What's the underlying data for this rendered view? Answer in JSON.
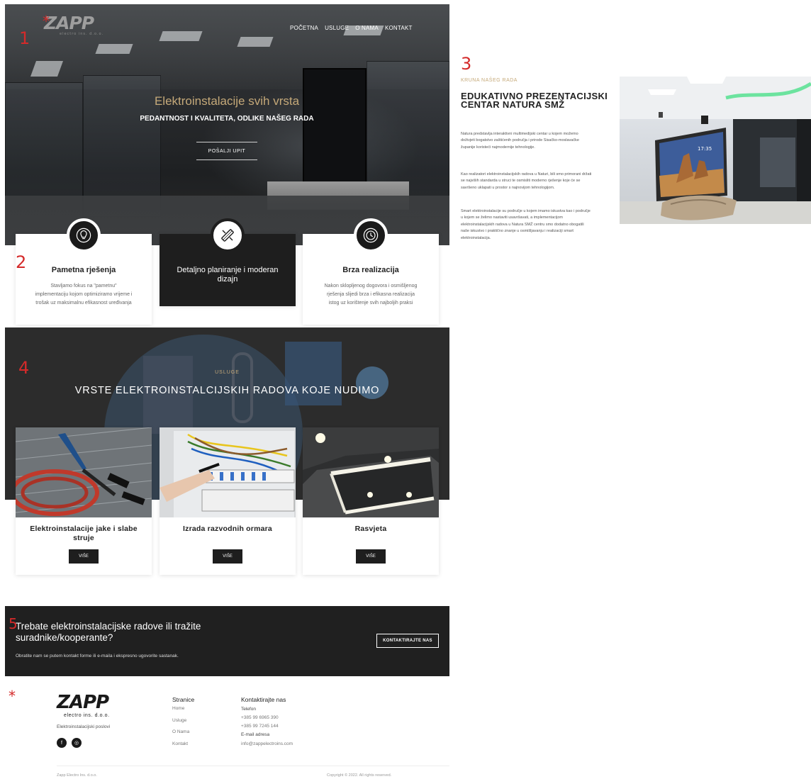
{
  "annotations": [
    "*",
    "1",
    "2",
    "3",
    "4",
    "5",
    "*"
  ],
  "brand": {
    "logo": "ZAPP",
    "sub": "electro ins. d.o.o."
  },
  "nav": [
    "POČETNA",
    "USLUGE",
    "O NAMA",
    "KONTAKT"
  ],
  "hero": {
    "title": "Elektroinstalacije svih vrsta",
    "subtitle": "PEDANTNOST I KVALITETA, ODLIKE NAŠEG RADA",
    "button": "POŠALJI UPIT"
  },
  "features": [
    {
      "icon": "lightbulb-icon",
      "title": "Pametna rješenja",
      "desc": "Stavljamo fokus na \"pametnu\" implementaciju kojom optimiziramo vrijeme i trošak uz maksimalnu efikasnost uređivanja"
    },
    {
      "icon": "pencil-ruler-icon",
      "title": "Detaljno planiranje i moderan dizajn",
      "desc": ""
    },
    {
      "icon": "clock-icon",
      "title": "Brza realizacija",
      "desc": "Nakon sklopljenog dogovora i osmišljenog rješenja slijedi brza i efikasna realizacija istog uz korištenje svih najboljih praksi"
    }
  ],
  "about": {
    "kicker": "KRUNA NAŠEG RADA",
    "title": "EDUKATIVNO PREZENTACIJSKI CENTAR NATURA SMŽ",
    "paragraphs": [
      "Natura predstavlja interaktivni multimedijski centar u kojem možemo doživjeti bogatstvo zaštićenih područja i prirode Sisačko-moslavačke županije koristeći najmodernije tehnologije.",
      "Kao realizatori elektroinstalacijskih radova u Naturi, bili smo primorani držati se najviših standarda u struci te osmisliti moderno rješenje koje će se savršeno uklapati u prostor s najnovijom tehnologijom.",
      "Smart elektroinstalacije su područje u kojem imamo iskustva kao i područje u kojem se želimo nastaviti usavršavati, a implementacijom elektroinstalacijskih radova u Natura SMŽ centru smo dodatno obogatili naše iskustvo i praktično znanje u osmišljavanju i realizaciji smart elektroinstalacija."
    ],
    "screen_time": "17:35"
  },
  "services": {
    "kicker": "USLUGE",
    "title": "VRSTE ELEKTROINSTALCIJSKIH RADOVA KOJE NUDIMO",
    "cards": [
      {
        "title": "Elektroinstalacije jake i slabe struje",
        "button": "VIŠE"
      },
      {
        "title": "Izrada razvodnih ormara",
        "button": "VIŠE"
      },
      {
        "title": "Rasvjeta",
        "button": "VIŠE"
      }
    ]
  },
  "cta": {
    "title": "Trebate elektroinstalacijske radove ili tražite suradnike/kooperante?",
    "desc": "Obratite nam se putem kontakt forme ili e-maila i ekspresno ugovorite sastanak.",
    "button": "KONTAKTIRAJTE NAS"
  },
  "footer": {
    "logo": "ZAPP",
    "logo_sub": "electro ins. d.o.o.",
    "tagline": "Elektroinstalacijski poslovi",
    "social": [
      {
        "icon": "facebook-icon",
        "glyph": "f"
      },
      {
        "icon": "instagram-icon",
        "glyph": "◎"
      }
    ],
    "pages_head": "Stranice",
    "pages": [
      "Home",
      "Usluge",
      "O Nama",
      "Kontakt"
    ],
    "contact_head": "Kontaktirajte nas",
    "phone_label": "Telefon",
    "phones": [
      "+385 99 6965 390",
      "+385 99 7245 144"
    ],
    "email_label": "E-mail adresa",
    "email": "info@zappelectroins.com",
    "bottom_left": "Zapp Electro Ins. d.o.o.",
    "bottom_right": "Copyright © 2022. All rights reserved."
  }
}
